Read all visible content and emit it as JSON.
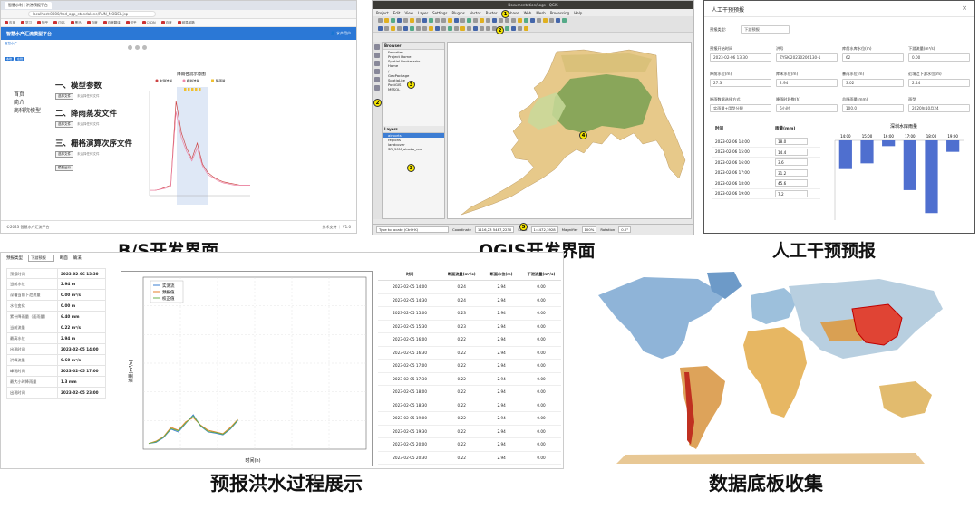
{
  "captions": {
    "bs": "B/S开发界面",
    "qgis": "QGIS开发界面",
    "manual": "人工干预预报",
    "flood": "预报洪水过程展示",
    "data": "数据底板收集"
  },
  "bs": {
    "tab": "智慧水利 | 洪涝预报平台",
    "url": "localhost:8080/hsd_app_standalone/RUN_MODEL.jsp",
    "bookmarks": [
      "应用",
      "学习",
      "知乎",
      "ITSS",
      "黑马",
      "百度",
      "百度翻译",
      "知乎",
      "CSDN",
      "百度",
      "网易邮箱"
    ],
    "title": "智慧水产汇流模型平台",
    "user": "水产用户",
    "site": "智慧水产",
    "tags": [
      "本地",
      "在线"
    ],
    "nav": [
      "首页",
      "简介",
      "商科院模型"
    ],
    "steps": [
      "一、模型参数",
      "二、降雨蒸发文件",
      "三、栅格演算次序文件"
    ],
    "btn": "选择文件",
    "note": "未选择任何文件",
    "run_btn": "模型运行",
    "chart_title": "降雨径流示意图",
    "legend": [
      "实测流量",
      "模拟流量",
      "降雨量"
    ],
    "footer_left": "©2023 智慧水产汇流平台",
    "footer_right": "技术支持 ｜ V1.0"
  },
  "qgis": {
    "window_title": "Documentation/Logs - QGIS",
    "menu": [
      "Project",
      "Edit",
      "View",
      "Layer",
      "Settings",
      "Plugins",
      "Vector",
      "Raster",
      "Database",
      "Web",
      "Mesh",
      "Processing",
      "Help"
    ],
    "browser_title": "Browser",
    "browser_items": [
      "Favorites",
      "Project Home",
      "Spatial Bookmarks",
      "Home",
      "/",
      "GeoPackage",
      "SpatiaLite",
      "PostGIS",
      "MSSQL"
    ],
    "layers_title": "Layers",
    "layer_items": [
      "airports",
      "regions",
      "landcover",
      "SR_50M_alaska_nad"
    ],
    "search_placeholder": "Type to locate (Ctrl+K)",
    "coordinate_label": "Coordinate",
    "coordinate": "1116,23 5487,2230",
    "scale_label": "Scale",
    "scale": "1:4472,3928",
    "magnifier_label": "Magnifier",
    "magnifier": "100%",
    "rotation_label": "Rotation",
    "rotation": "0.0°",
    "badges": [
      "1",
      "2",
      "3",
      "4",
      "5"
    ],
    "colors": {
      "land_high": "#e9c178",
      "land_mid": "#c9dca0",
      "forest": "#3e8a3a",
      "sea": "#ffffff"
    }
  },
  "manual": {
    "title": "人工干预预报",
    "type_label": "预报类型:",
    "type_value": "下游预报",
    "fields": [
      {
        "label": "预报开始时间",
        "value": "2023-02-06 13:30"
      },
      {
        "label": "洪号",
        "value": "ZYSK-20230206130-1"
      },
      {
        "label": "库前水库水位(m)",
        "value": "62"
      },
      {
        "label": "下游流量(m³/s)",
        "value": "0.00"
      },
      {
        "label": "降前水位(m)",
        "value": "27.3"
      },
      {
        "label": "库末水位(m)",
        "value": "2.94"
      },
      {
        "label": "暴雨水位(m)",
        "value": "3.02"
      },
      {
        "label": "近境江下游水位(m)",
        "value": "2.44"
      },
      {
        "label": "降雨数据选择方式",
        "value": "实雨量+用型分配"
      },
      {
        "label": "降雨时段数(h)",
        "value": "6小时"
      },
      {
        "label": "总降雨量(mm)",
        "value": "100.0"
      },
      {
        "label": "雨型",
        "value": "2020年10月24"
      }
    ],
    "table_head": [
      "时间",
      "雨量(mm)"
    ],
    "rows": [
      {
        "t": "2023-02-06 14:00",
        "v": "18.0"
      },
      {
        "t": "2023-02-06 15:00",
        "v": "14.4"
      },
      {
        "t": "2023-02-06 16:00",
        "v": "3.6"
      },
      {
        "t": "2023-02-06 17:00",
        "v": "31.2"
      },
      {
        "t": "2023-02-06 18:00",
        "v": "45.6"
      },
      {
        "t": "2023-02-06 19:00",
        "v": "7.2"
      }
    ],
    "chart_title": "深圳水库雨量"
  },
  "flood": {
    "type_label": "预报类型",
    "type_value": "下游预报",
    "sw_label": "断面",
    "sw_value": "确溪",
    "info": [
      {
        "k": "预报时间",
        "v": "2023-02-06 13:30"
      },
      {
        "k": "当前水位",
        "v": "2.94 m"
      },
      {
        "k": "深槽当前下泄流量",
        "v": "0.00 m³/s"
      },
      {
        "k": "水位变化",
        "v": "0.00 m"
      },
      {
        "k": "累计降雨量（面雨量）",
        "v": "6.40 mm"
      },
      {
        "k": "当前流量",
        "v": "0.22 m³/s"
      },
      {
        "k": "最高水位",
        "v": "2.94 m"
      },
      {
        "k": "出现时间",
        "v": "2023-02-05 14:00"
      },
      {
        "k": "洪峰流量",
        "v": "0.60 m³/s"
      },
      {
        "k": "峰现时间",
        "v": "2023-02-05 17:00"
      },
      {
        "k": "最大小时降雨量",
        "v": "1.3 mm"
      },
      {
        "k": "出现时间",
        "v": "2023-02-05 23:00"
      }
    ],
    "chart_legend": [
      "实测流",
      "预报值",
      "校正值"
    ],
    "chart_ylabel": "流量(m³/s)",
    "chart_xlabel": "时间(h)",
    "table_head": [
      "时间",
      "断面流量(m³/s)",
      "断面水位(m)",
      "下泄流量(m³/s)"
    ],
    "rows": [
      [
        "2023-02-05 14:00",
        "0.24",
        "2.94",
        "0.00"
      ],
      [
        "2023-02-05 14:30",
        "0.24",
        "2.94",
        "0.00"
      ],
      [
        "2023-02-05 15:00",
        "0.23",
        "2.94",
        "0.00"
      ],
      [
        "2023-02-05 15:30",
        "0.23",
        "2.94",
        "0.00"
      ],
      [
        "2023-02-05 16:00",
        "0.22",
        "2.94",
        "0.00"
      ],
      [
        "2023-02-05 16:30",
        "0.22",
        "2.94",
        "0.00"
      ],
      [
        "2023-02-05 17:00",
        "0.22",
        "2.94",
        "0.00"
      ],
      [
        "2023-02-05 17:30",
        "0.22",
        "2.94",
        "0.00"
      ],
      [
        "2023-02-05 18:00",
        "0.22",
        "2.94",
        "0.00"
      ],
      [
        "2023-02-05 18:30",
        "0.22",
        "2.94",
        "0.00"
      ],
      [
        "2023-02-05 19:00",
        "0.22",
        "2.94",
        "0.00"
      ],
      [
        "2023-02-05 19:30",
        "0.22",
        "2.94",
        "0.00"
      ],
      [
        "2023-02-05 20:00",
        "0.22",
        "2.94",
        "0.00"
      ],
      [
        "2023-02-05 20:30",
        "0.22",
        "2.94",
        "0.00"
      ]
    ]
  },
  "chart_data": [
    {
      "type": "line",
      "title": "降雨径流示意图",
      "series": [
        {
          "name": "实测流量",
          "values": [
            0.05,
            0.05,
            0.06,
            0.08,
            0.1,
            0.9,
            0.6,
            0.45,
            0.35,
            0.5,
            0.3,
            0.22,
            0.18,
            0.15,
            0.13,
            0.12,
            0.11,
            0.1,
            0.1,
            0.1
          ]
        },
        {
          "name": "模拟流量",
          "values": [
            0.05,
            0.05,
            0.06,
            0.07,
            0.09,
            0.8,
            0.55,
            0.42,
            0.33,
            0.45,
            0.28,
            0.2,
            0.17,
            0.14,
            0.12,
            0.11,
            0.1,
            0.1,
            0.1,
            0.1
          ]
        }
      ],
      "ylim": [
        0,
        1
      ]
    },
    {
      "type": "bar",
      "title": "深圳水库雨量",
      "categories": [
        "14:00",
        "15:00",
        "16:00",
        "17:00",
        "18:00",
        "19:00"
      ],
      "values": [
        -18.0,
        -14.4,
        -3.6,
        -31.2,
        -45.6,
        -7.2
      ],
      "ylim": [
        -50,
        0
      ]
    },
    {
      "type": "line",
      "series": [
        {
          "name": "实测流",
          "values": [
            0.1,
            0.12,
            0.2,
            0.35,
            0.3,
            0.45,
            0.6,
            0.4,
            0.3,
            0.28,
            0.25,
            0.35,
            0.5
          ]
        },
        {
          "name": "预报值",
          "values": [
            0.1,
            0.14,
            0.22,
            0.38,
            0.33,
            0.48,
            0.55,
            0.42,
            0.33,
            0.3,
            0.27,
            0.38,
            0.52
          ]
        },
        {
          "name": "校正值",
          "values": [
            0.1,
            0.13,
            0.21,
            0.36,
            0.32,
            0.46,
            0.58,
            0.41,
            0.31,
            0.29,
            0.26,
            0.36,
            0.51
          ]
        }
      ],
      "ylabel": "流量(m³/s)",
      "xlabel": "时间(h)",
      "ylim": [
        0,
        3
      ]
    }
  ]
}
